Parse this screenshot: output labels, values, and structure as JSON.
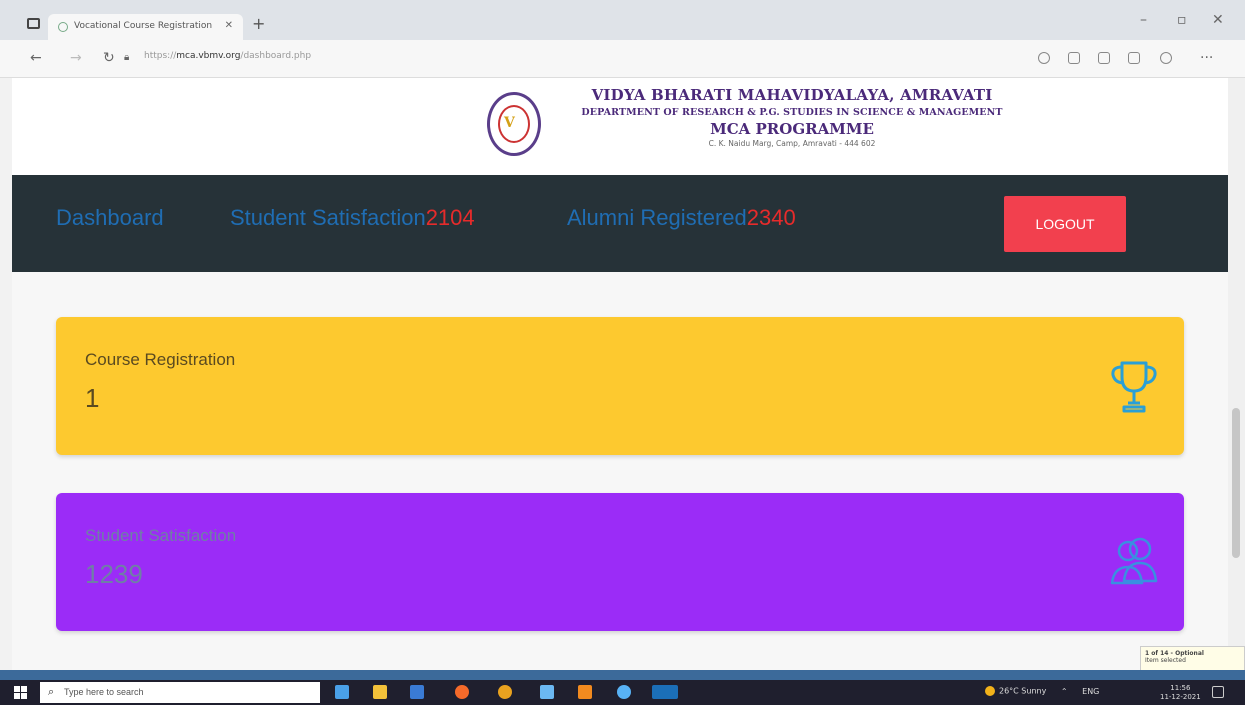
{
  "browser": {
    "tab_title": "Vocational Course Registration",
    "url_host": "mca.vbmv.org",
    "url_path": "/dashboard.php",
    "url_prefix": "https://"
  },
  "header": {
    "college_name": "VIDYA BHARATI MAHAVIDYALAYA, AMRAVATI",
    "department": "DEPARTMENT OF RESEARCH & P.G. STUDIES IN SCIENCE & MANAGEMENT",
    "programme": "MCA PROGRAMME",
    "address": "C. K. Naidu Marg, Camp, Amravati - 444 602"
  },
  "nav": {
    "dashboard_label": "Dashboard",
    "satisfaction_label": "Student Satisfaction",
    "satisfaction_count": "2104",
    "alumni_label": "Alumni Registered",
    "alumni_count": "2340",
    "logout_label": "LOGOUT"
  },
  "cards": {
    "course": {
      "label": "Course Registration",
      "value": "1",
      "icon": "trophy-icon"
    },
    "satisfaction": {
      "label": "Student Satisfaction",
      "value": "1239",
      "icon": "users-icon"
    }
  },
  "taskbar": {
    "search_placeholder": "Type here to search",
    "weather": "26°C Sunny",
    "lang": "ENG",
    "time": "11:56",
    "date": "11-12-2021"
  },
  "popup": {
    "line1": "1 of 14 - Optional",
    "line2": "Item selected"
  },
  "colors": {
    "navbar": "#263238",
    "nav_link": "#1f6db3",
    "nav_count": "#e62b2b",
    "logout": "#f2404e",
    "card_course": "#fdc92f",
    "card_satisfaction": "#9b2cf7",
    "header_text": "#4b2a7a"
  }
}
